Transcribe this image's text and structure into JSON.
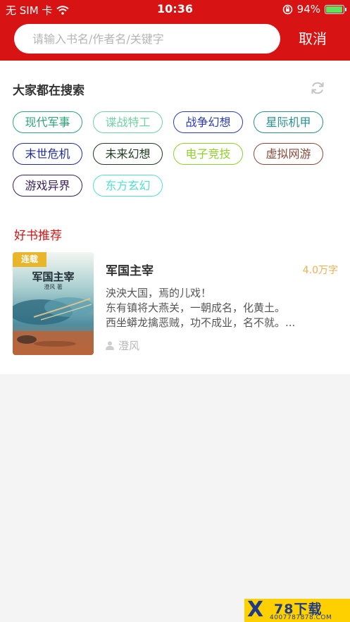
{
  "status_bar": {
    "carrier": "无 SIM 卡",
    "time": "10:36",
    "battery": "94%",
    "battery_level": 0.94
  },
  "search": {
    "placeholder": "请输入书名/作者名/关键字",
    "cancel_label": "取消"
  },
  "hot_search": {
    "title": "大家都在搜索",
    "tags": [
      {
        "label": "现代军事",
        "color": "#2da37a"
      },
      {
        "label": "谍战特工",
        "color": "#6fd1a4"
      },
      {
        "label": "战争幻想",
        "color": "#2b3db8"
      },
      {
        "label": "星际机甲",
        "color": "#2a8f8f"
      },
      {
        "label": "末世危机",
        "color": "#1f2c9c"
      },
      {
        "label": "未来幻想",
        "color": "#1f3b1f"
      },
      {
        "label": "电子竞技",
        "color": "#8fd12a"
      },
      {
        "label": "虚拟网游",
        "color": "#8a4a3a"
      },
      {
        "label": "游戏异界",
        "color": "#3a1f5c"
      },
      {
        "label": "东方玄幻",
        "color": "#4fe0d1"
      }
    ]
  },
  "recommend": {
    "title": "好书推荐",
    "books": [
      {
        "name": "军国主宰",
        "words": "4.0万字",
        "badge": "连载",
        "cover_title": "军国主宰",
        "cover_author": "澄风 著",
        "desc": [
          "泱泱大国，焉的儿戏！",
          "东有镇将大燕关，一朝成名，化黄土。",
          "西坐蟒龙擒恶贼，功不成业，名不就。..."
        ],
        "author": "澄风"
      }
    ]
  },
  "watermark": {
    "logo": "X",
    "title": "78下载",
    "site": "4007787878.COM"
  }
}
